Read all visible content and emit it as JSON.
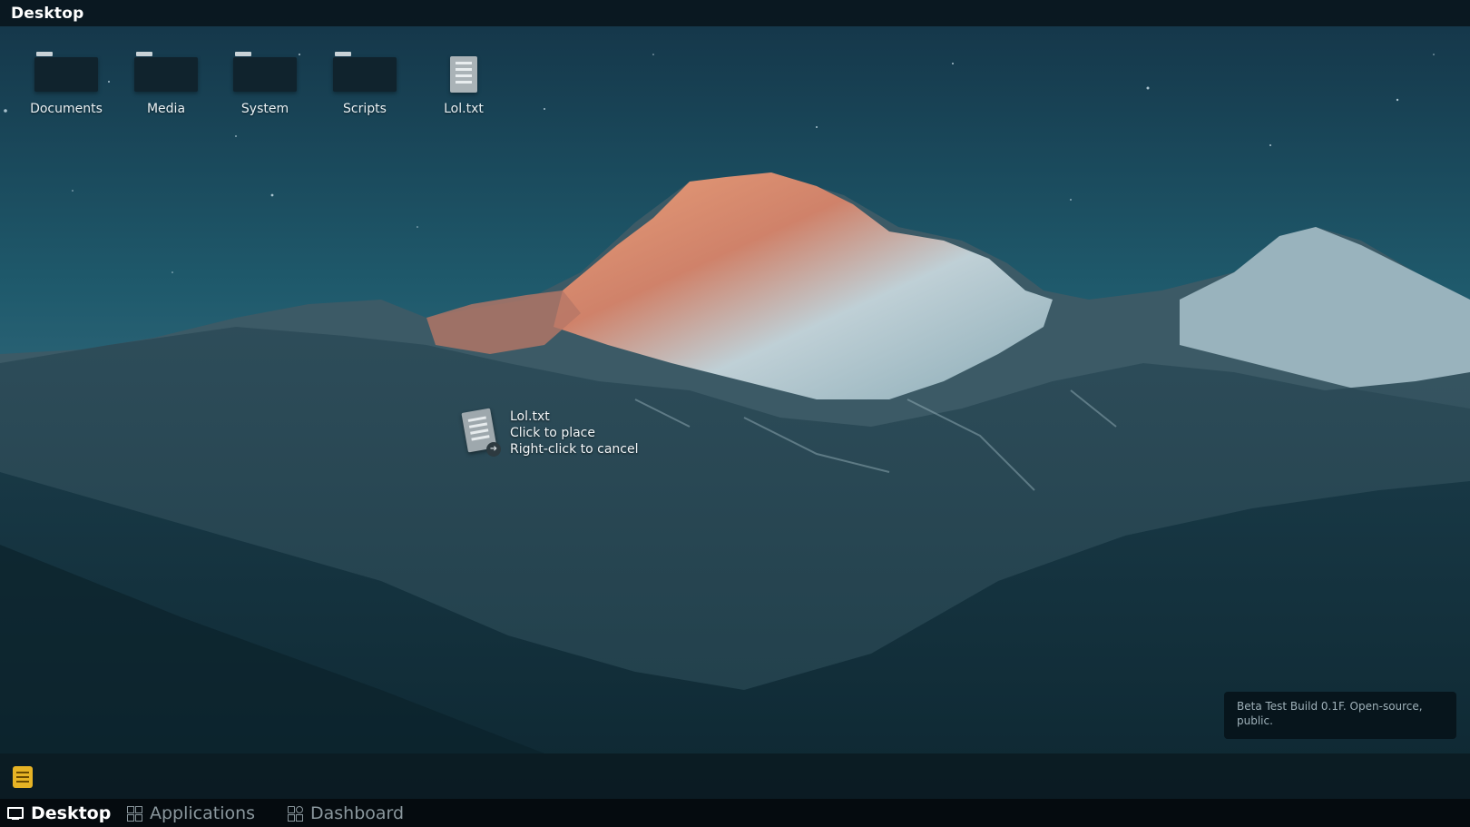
{
  "window": {
    "title": "Desktop"
  },
  "desktop_icons": [
    {
      "label": "Documents",
      "type": "folder"
    },
    {
      "label": "Media",
      "type": "folder"
    },
    {
      "label": "System",
      "type": "folder"
    },
    {
      "label": "Scripts",
      "type": "folder"
    },
    {
      "label": "Lol.txt",
      "type": "text-file"
    }
  ],
  "drag_tooltip": {
    "filename": "Lol.txt",
    "line1": "Click to place",
    "line2": "Right-click to cancel"
  },
  "build_note": "Beta Test Build 0.1F. Open-source, public.",
  "tray": {
    "icon": "notes-icon"
  },
  "taskbar": {
    "items": [
      {
        "label": "Desktop",
        "icon": "monitor-icon",
        "active": true
      },
      {
        "label": "Applications",
        "icon": "grid-icon",
        "active": false
      },
      {
        "label": "Dashboard",
        "icon": "dashboard-icon",
        "active": false
      }
    ]
  },
  "colors": {
    "accent_notes": "#e6b325",
    "taskbar_bg": "#050b0f",
    "topbar_bg": "#0b1820",
    "inactive_text": "#8a979d"
  }
}
